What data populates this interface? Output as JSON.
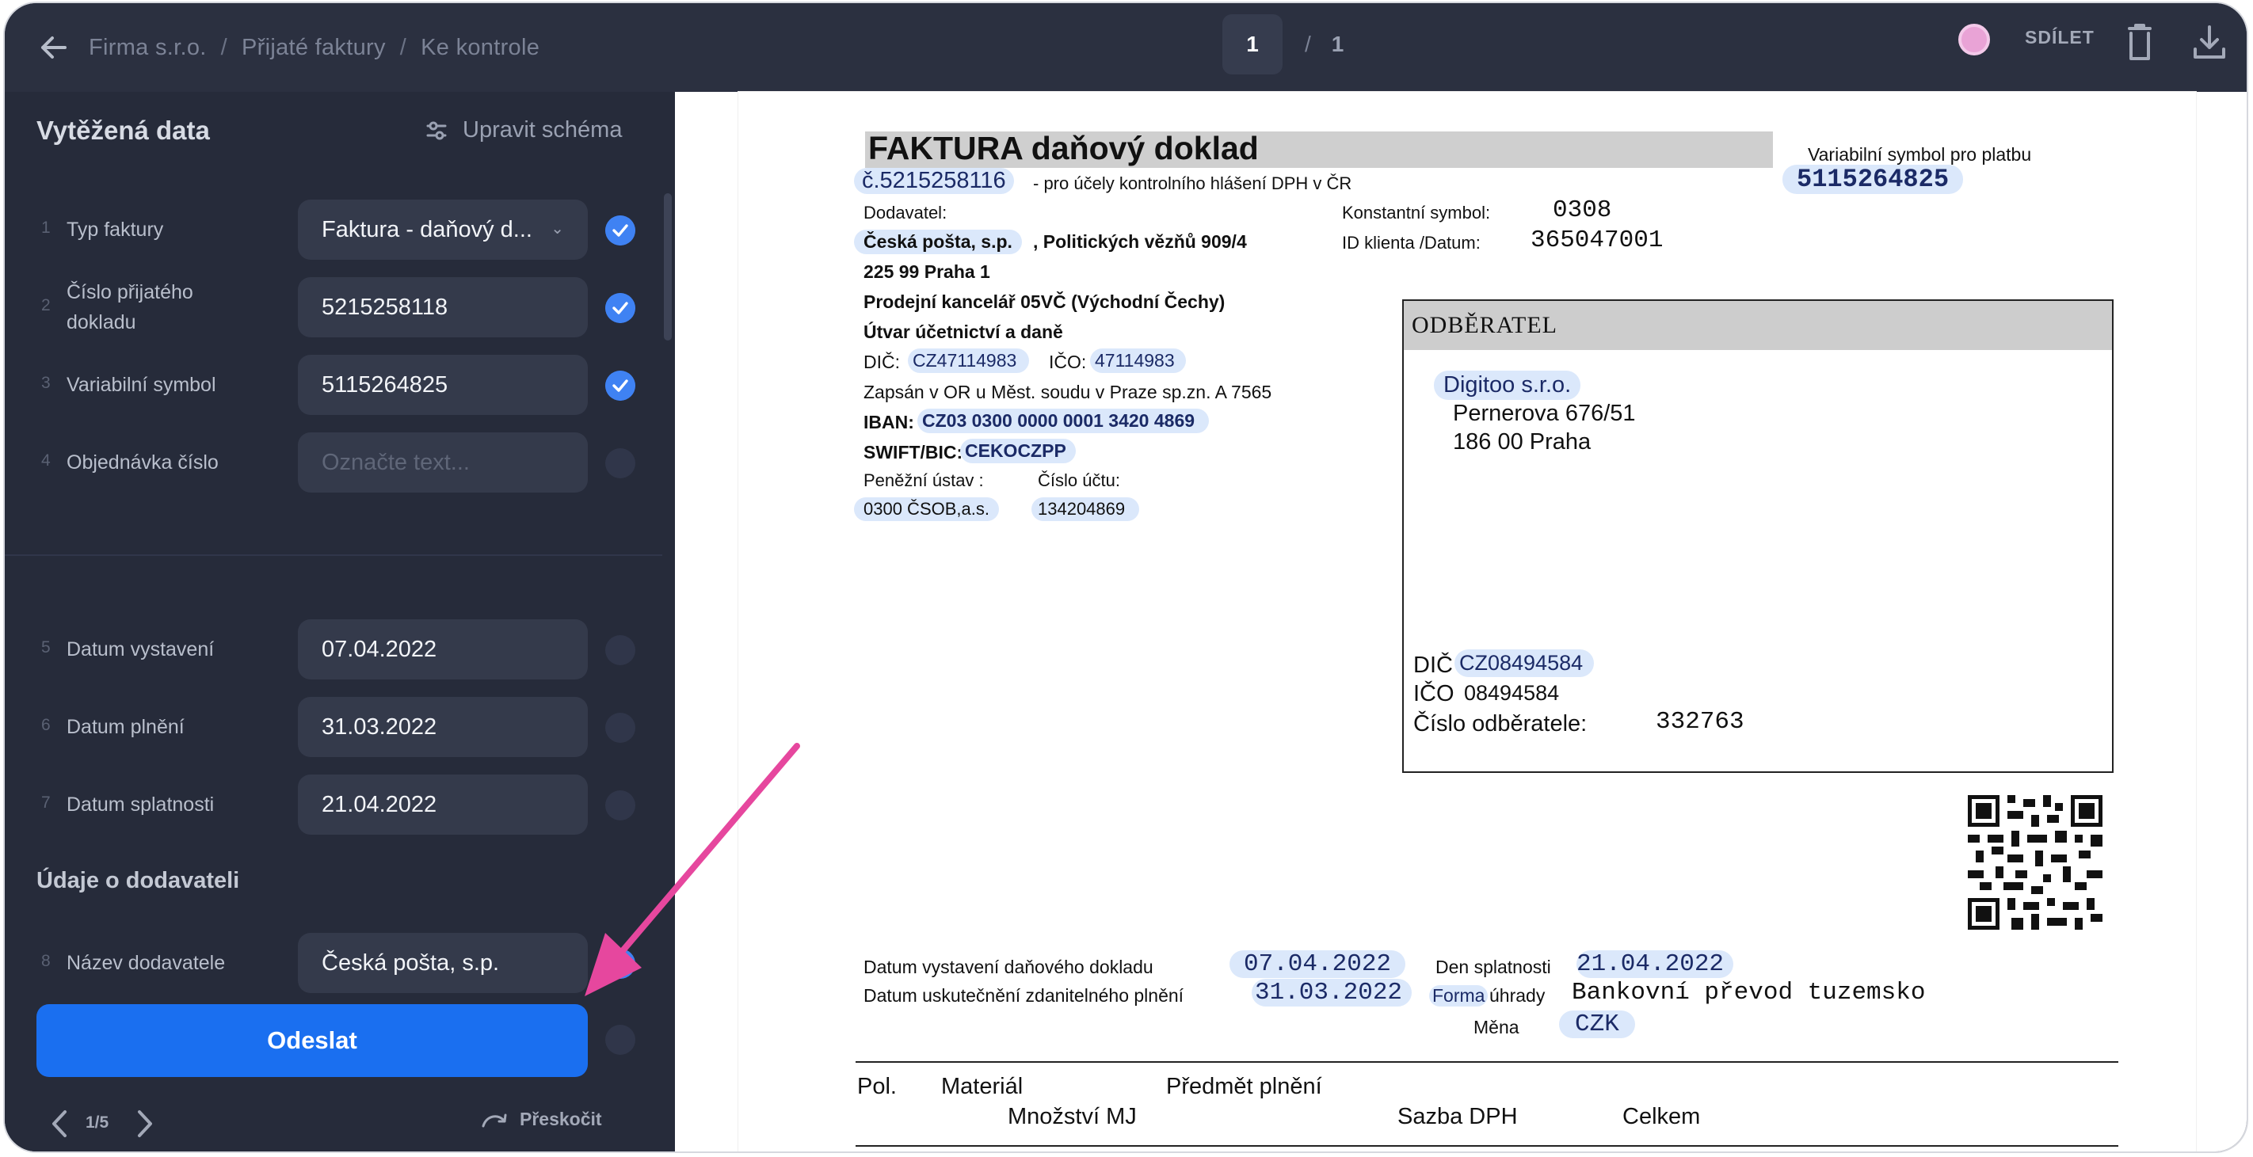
{
  "topbar": {
    "breadcrumb": [
      "Firma s.r.o.",
      "Přijaté faktury",
      "Ke kontrole"
    ],
    "page_current": "1",
    "page_separator": "/",
    "page_total": "1",
    "share_label": "SDÍLET"
  },
  "sidebar": {
    "title": "Vytěžená data",
    "schema_label": "Upravit schéma",
    "fields": [
      {
        "num": "1",
        "label": "Typ faktury",
        "value": "Faktura - daňový d...",
        "checked": true
      },
      {
        "num": "2",
        "label": "Číslo přijatého dokladu",
        "value": "5215258118",
        "checked": true
      },
      {
        "num": "3",
        "label": "Variabilní symbol",
        "value": "5115264825",
        "checked": true
      },
      {
        "num": "4",
        "label": "Objednávka číslo",
        "value": "",
        "placeholder": "Označte text...",
        "checked": false
      },
      {
        "num": "5",
        "label": "Datum vystavení",
        "value": "07.04.2022",
        "checked": false
      },
      {
        "num": "6",
        "label": "Datum plnění",
        "value": "31.03.2022",
        "checked": false
      },
      {
        "num": "7",
        "label": "Datum splatnosti",
        "value": "21.04.2022",
        "checked": false
      },
      {
        "num": "8",
        "label": "Název dodavatele",
        "value": "Česká pošta, s.p.",
        "checked": true
      }
    ],
    "section_supplier": "Údaje o dodavateli",
    "submit_label": "Odeslat",
    "doc_counter": "1/5",
    "skip_label": "Přeskočit"
  },
  "colors": {
    "accent": "#1a6ff0",
    "check": "#3f82f3",
    "highlight": "#dbe8fb",
    "arrow": "#e6479e"
  },
  "document": {
    "title": "FAKTURA daňový doklad",
    "number": "č.5215258116",
    "number_note": "-  pro účely kontrolního hlášení DPH v ČR",
    "vs_label": "Variabilní symbol pro platbu",
    "vs_value": "5115264825",
    "supplier_label": "Dodavatel:",
    "supplier_name": "Česká pošta, s.p.",
    "supplier_addr1": ", Politických vězňů 909/4",
    "supplier_addr2": "225 99 Praha 1",
    "supplier_office": "Prodejní kancelář 05VČ (Východní Čechy)",
    "supplier_dept": "Útvar účetnictví a daně",
    "dic_label": "DIČ:",
    "dic_value": "CZ47114983",
    "ico_label": "IČO:",
    "ico_value": "47114983",
    "register": "Zapsán v OR u Měst. soudu v Praze sp.zn. A 7565",
    "iban_label": "IBAN:",
    "iban_value": "CZ03 0300 0000 0001 3420 4869",
    "swift_label": "SWIFT/BIC:",
    "swift_value": "CEKOCZPP",
    "bank_label": "Peněžní ústav :",
    "account_label": "Číslo účtu:",
    "bank_value": "0300 ČSOB,a.s.",
    "account_value": "134204869",
    "const_label": "Konstantní symbol:",
    "const_value": "0308",
    "client_label": "ID klienta /Datum:",
    "client_value": "365047001",
    "buyer_head": "ODBĚRATEL",
    "buyer_name": "Digitoo s.r.o.",
    "buyer_street": "Pernerova 676/51",
    "buyer_city": "186 00 Praha",
    "buyer_dic_label": "DIČ",
    "buyer_dic_value": "CZ08494584",
    "buyer_ico_label": "IČO",
    "buyer_ico_value": "08494584",
    "buyer_no_label": "Číslo odběratele:",
    "buyer_no_value": "332763",
    "issue_label": "Datum vystavení daňového dokladu",
    "issue_value": "07.04.2022",
    "due_label": "Den splatnosti",
    "due_value": "21.04.2022",
    "taxable_label": "Datum uskutečnění zdanitelného plnění",
    "taxable_value": "31.03.2022",
    "payment_label_a": "Forma",
    "payment_label_b": "úhrady",
    "payment_value": "Bankovní převod tuzemsko",
    "currency_label": "Měna",
    "currency_value": "CZK",
    "col_pol": "Pol.",
    "col_material": "Materiál",
    "col_subject": "Předmět plnění",
    "col_qty": "Množství MJ",
    "col_vat": "Sazba DPH",
    "col_total": "Celkem"
  }
}
